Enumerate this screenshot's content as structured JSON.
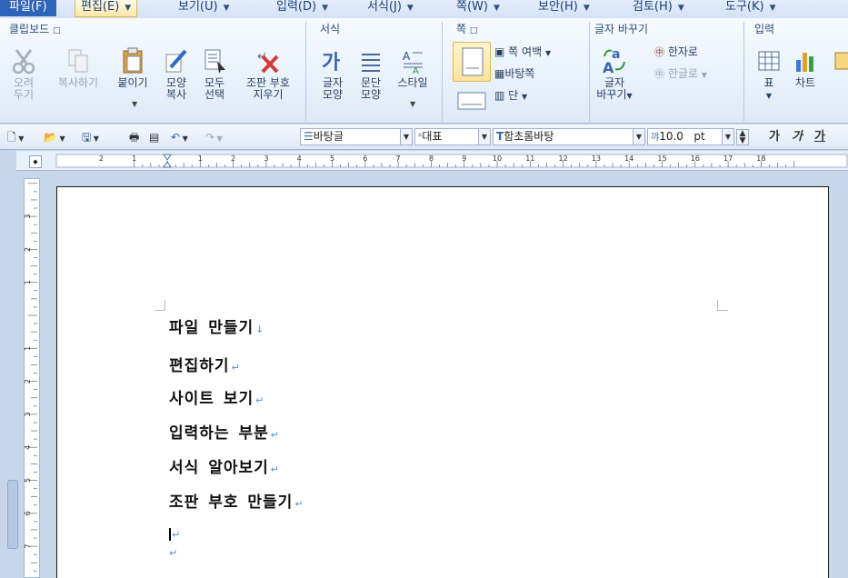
{
  "menu": {
    "file": "파일(F)",
    "edit": "편집(E)",
    "view": "보기(U)",
    "insert": "입력(D)",
    "format": "서식(J)",
    "page": "쪽(W)",
    "security": "보안(H)",
    "review": "검토(H)",
    "tools": "도구(K)"
  },
  "ribbon": {
    "clipboard": {
      "title": "클립보드",
      "cut": [
        "오려",
        "두기"
      ],
      "copy": [
        "복사하기"
      ],
      "paste": [
        "붙이기"
      ],
      "format_copy": [
        "모양",
        "복사"
      ],
      "select_all": [
        "모두",
        "선택"
      ],
      "clear_marks": [
        "조판 부호",
        "지우기"
      ]
    },
    "format": {
      "title": "서식",
      "char_shape": [
        "글자",
        "모양"
      ],
      "para_shape": [
        "문단",
        "모양"
      ],
      "style": [
        "스타일"
      ]
    },
    "page": {
      "title": "쪽",
      "margin": "쪽 여백",
      "background": "바탕쪽",
      "columns": "단"
    },
    "convert": {
      "title": "글자 바꾸기",
      "hanja": "한자로",
      "hangul": "한글로",
      "change": [
        "글자",
        "바꾸기"
      ]
    },
    "insert": {
      "title": "입력",
      "table": "표",
      "chart": "차트"
    }
  },
  "toolbar": {
    "style": "바탕글",
    "lang": "대표",
    "font": "함초롬바탕",
    "size": "10.0",
    "unit": "pt",
    "bold": "가",
    "italic": "가",
    "underline": "가"
  },
  "ruler": {
    "numbers": [
      "2",
      "1",
      "1",
      "2",
      "3",
      "4",
      "5",
      "6",
      "7",
      "8",
      "9",
      "10",
      "11",
      "12",
      "13",
      "14",
      "15",
      "16",
      "17",
      "18"
    ],
    "v_numbers": [
      "3",
      "2",
      "1",
      "1",
      "2",
      "3",
      "4",
      "5",
      "6",
      "7"
    ]
  },
  "document": {
    "lines": [
      "파일 만들기",
      "편집하기",
      "사이트 보기",
      "입력하는 부분",
      "서식 알아보기",
      "조판 부호 만들기"
    ]
  }
}
